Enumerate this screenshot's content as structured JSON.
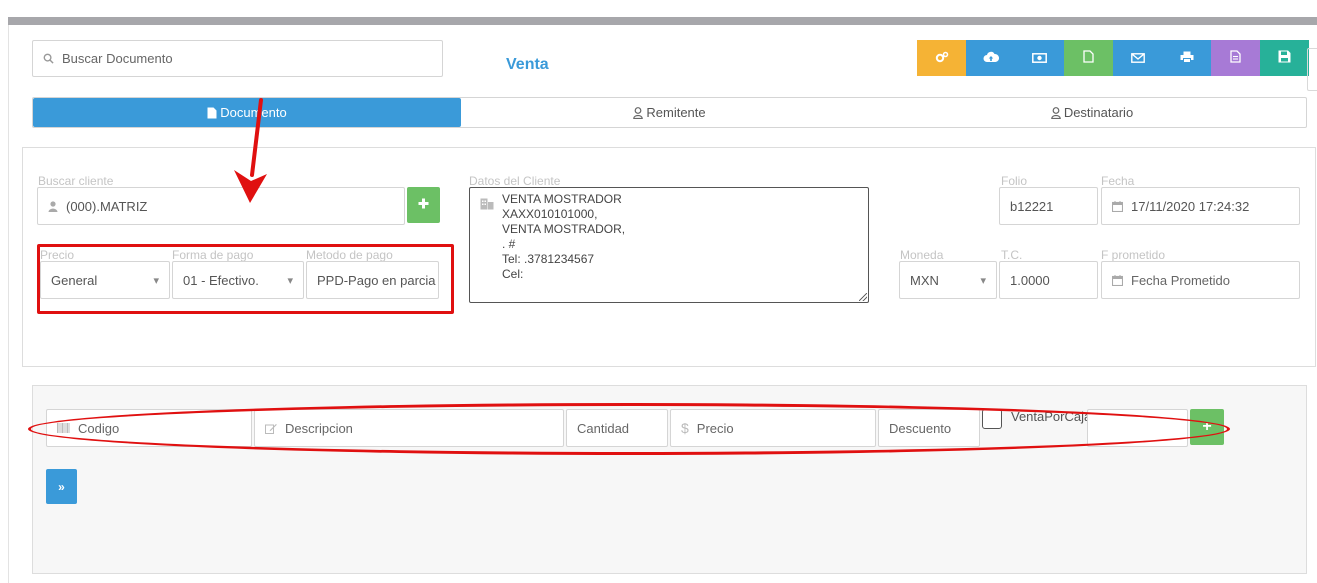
{
  "search": {
    "placeholder": "Buscar Documento"
  },
  "page_title": "Venta",
  "toolbar": {
    "buttons": [
      {
        "icon": "gears-icon",
        "color": "#f5b335"
      },
      {
        "icon": "cloud-upload-icon",
        "color": "#3a9ad9"
      },
      {
        "icon": "money-icon",
        "color": "#3a9ad9"
      },
      {
        "icon": "file-icon",
        "color": "#6cc065"
      },
      {
        "icon": "envelope-icon",
        "color": "#3a9ad9"
      },
      {
        "icon": "print-icon",
        "color": "#3a9ad9"
      },
      {
        "icon": "file-text-icon",
        "color": "#a77ad6"
      },
      {
        "icon": "save-icon",
        "color": "#27b199"
      }
    ]
  },
  "tabs": [
    {
      "label": "Documento",
      "icon": "file-icon",
      "active": true
    },
    {
      "label": "Remitente",
      "icon": "user-icon",
      "active": false
    },
    {
      "label": "Destinatario",
      "icon": "user-icon",
      "active": false
    }
  ],
  "client_search": {
    "label": "Buscar cliente",
    "value": "(000).MATRIZ"
  },
  "precio": {
    "label": "Precio",
    "value": "General"
  },
  "forma_pago": {
    "label": "Forma de pago",
    "value": "01 - Efectivo."
  },
  "metodo_pago": {
    "label": "Metodo de pago",
    "value": "PPD-Pago en parcia"
  },
  "datos_cliente": {
    "label": "Datos del Cliente",
    "lines": [
      "VENTA MOSTRADOR",
      "XAXX010101000,",
      "VENTA MOSTRADOR,",
      ". #",
      "Tel: .3781234567",
      "Cel:"
    ]
  },
  "folio": {
    "label": "Folio",
    "value": "b12221"
  },
  "fecha": {
    "label": "Fecha",
    "value": "17/11/2020 17:24:32"
  },
  "moneda": {
    "label": "Moneda",
    "value": "MXN"
  },
  "tc": {
    "label": "T.C.",
    "value": "1.0000"
  },
  "f_prometido": {
    "label": "F prometido",
    "placeholder": "Fecha Prometido"
  },
  "item_row": {
    "codigo": "Codigo",
    "descripcion": "Descripcion",
    "cantidad": "Cantidad",
    "precio": "Precio",
    "descuento": "Descuento",
    "venta_por_caja": "VentaPorCaja",
    "add_label": "+"
  },
  "next_button": {
    "label": "»"
  },
  "colors": {
    "accent": "#3a9ad9",
    "success": "#6cc065",
    "annotation": "#e01010"
  }
}
